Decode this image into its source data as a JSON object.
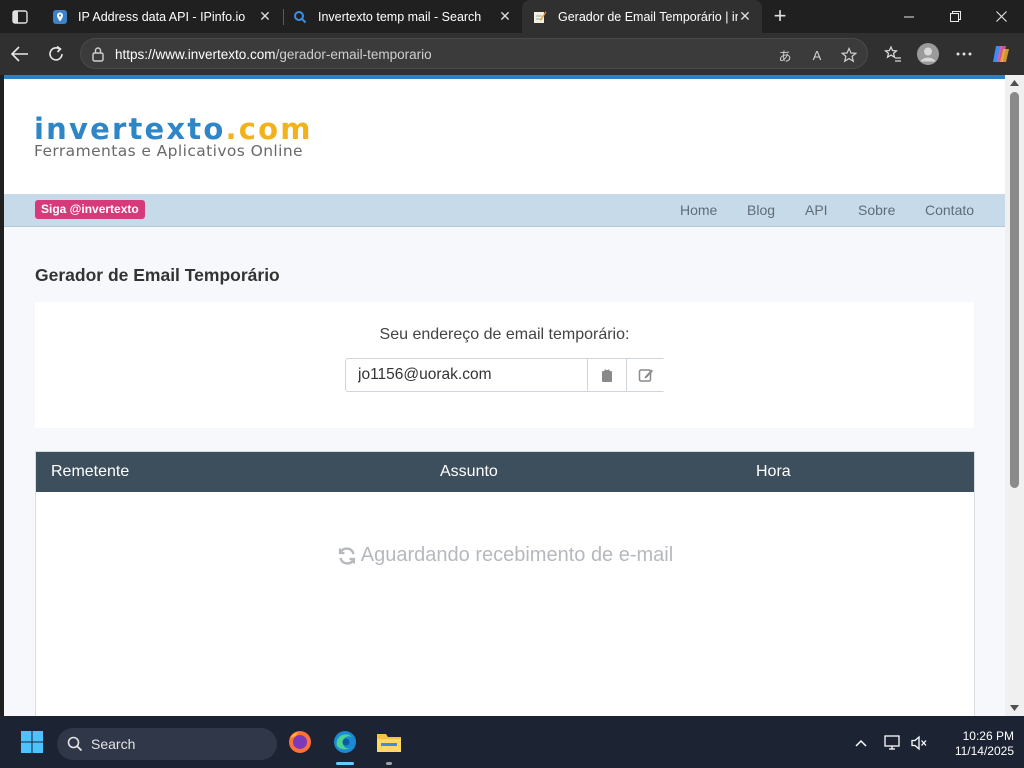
{
  "browser": {
    "tabs": [
      {
        "title": "IP Address data API - IPinfo.io",
        "favicon": "ipinfo-shield-icon",
        "active": false
      },
      {
        "title": "Invertexto temp mail - Search",
        "favicon": "bing-search-icon",
        "active": false
      },
      {
        "title": "Gerador de Email Temporário | invertexto",
        "favicon": "notepad-icon",
        "active": true
      }
    ],
    "url_domain": "https://www.invertexto.com",
    "url_path": "/gerador-email-temporario",
    "new_tab_symbol": "+"
  },
  "site": {
    "logo_part1": "invertexto",
    "logo_part2": ".com",
    "logo_tagline": "Ferramentas e Aplicativos Online",
    "follow_badge": "Siga @invertexto",
    "nav": [
      {
        "label": "Home"
      },
      {
        "label": "Blog"
      },
      {
        "label": "API"
      },
      {
        "label": "Sobre"
      },
      {
        "label": "Contato"
      }
    ]
  },
  "main": {
    "title": "Gerador de Email Temporário",
    "email_label": "Seu endereço de email temporário:",
    "email_value": "jo1156@uorak.com",
    "inbox_columns": [
      "Remetente",
      "Assunto",
      "Hora"
    ],
    "waiting_text": "Aguardando recebimento de e-mail"
  },
  "taskbar": {
    "search_label": "Search",
    "time": "10:26 PM",
    "date": "11/14/2025"
  },
  "colors": {
    "brand_blue": "#2f86c7",
    "brand_yellow": "#f2b31a",
    "badge_pink": "#d63a7a",
    "table_header": "#3d4f5d"
  }
}
